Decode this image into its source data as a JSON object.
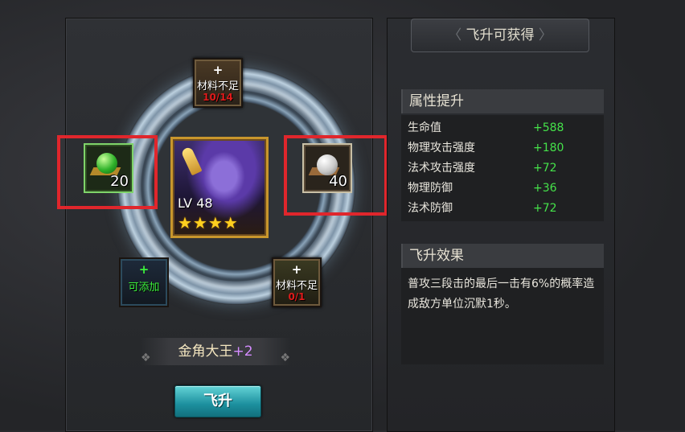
{
  "left": {
    "slots": {
      "top": {
        "plus": "+",
        "status": "材料不足",
        "count": "10/14"
      },
      "bottom_left": {
        "plus": "+",
        "status": "可添加"
      },
      "bottom_right": {
        "plus": "+",
        "status": "材料不足",
        "count": "0/1"
      }
    },
    "gems": {
      "green": {
        "count": "20",
        "icon": "green-gem-icon"
      },
      "silver": {
        "count": "40",
        "icon": "silver-pearl-icon"
      }
    },
    "hero": {
      "level": "LV 48",
      "stars": "★★★★",
      "star_count": 4
    },
    "name": {
      "label": "金角大王",
      "plus": "+2"
    },
    "ascend_button": "飞升"
  },
  "right": {
    "header": "飞升可获得",
    "attributes_title": "属性提升",
    "stats": [
      {
        "name": "生命值",
        "value": "+588"
      },
      {
        "name": "物理攻击强度",
        "value": "+180"
      },
      {
        "name": "法术攻击强度",
        "value": "+72"
      },
      {
        "name": "物理防御",
        "value": "+36"
      },
      {
        "name": "法术防御",
        "value": "+72"
      }
    ],
    "effect_title": "飞升效果",
    "effect_text": "普攻三段击的最后一击有6%的概率造成敌方单位沉默1秒。"
  },
  "colors": {
    "stat_value": "#45e34a",
    "highlight": "#e0262c",
    "insufficient": "#e01b1b",
    "addable": "#3bf03b"
  }
}
